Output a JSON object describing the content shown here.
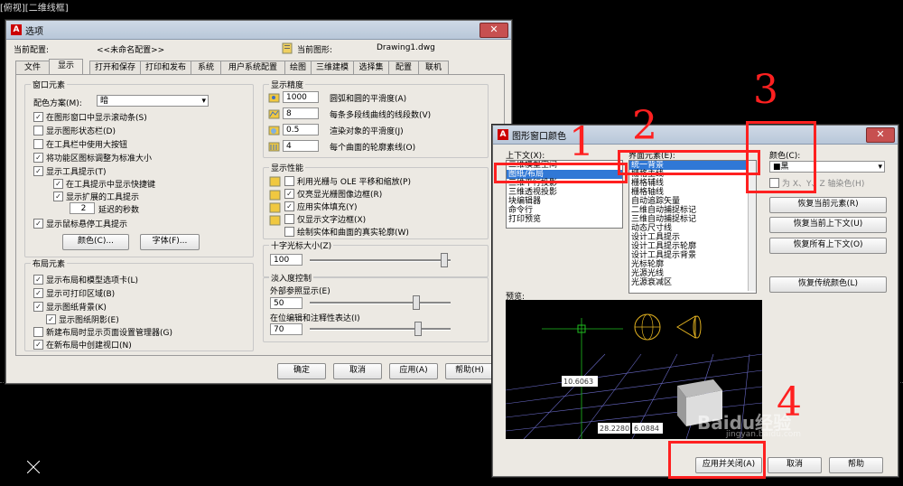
{
  "cad": {
    "title": "[俯视][二维线框]"
  },
  "options": {
    "title": "选项",
    "profile_label": "当前配置:",
    "profile_value": "<<未命名配置>>",
    "drawing_label": "当前图形:",
    "drawing_value": "Drawing1.dwg",
    "tabs": [
      "文件",
      "显示",
      "打开和保存",
      "打印和发布",
      "系统",
      "用户系统配置",
      "绘图",
      "三维建模",
      "选择集",
      "配置",
      "联机"
    ],
    "window": {
      "title": "窗口元素",
      "scheme_label": "配色方案(M):",
      "scheme_value": "暗",
      "checks": [
        "在图形窗口中显示滚动条(S)",
        "显示图形状态栏(D)",
        "在工具栏中使用大按钮",
        "将功能区图标调整为标准大小",
        "显示工具提示(T)",
        "在工具提示中显示快捷键",
        "显示扩展的工具提示",
        "显示鼠标悬停工具提示"
      ],
      "delay_value": "2",
      "delay_label": "延迟的秒数",
      "colors_btn": "颜色(C)...",
      "fonts_btn": "字体(F)..."
    },
    "layout": {
      "title": "布局元素",
      "checks": [
        "显示布局和模型选项卡(L)",
        "显示可打印区域(B)",
        "显示图纸背景(K)",
        "显示图纸阴影(E)",
        "新建布局时显示页面设置管理器(G)",
        "在新布局中创建视口(N)"
      ]
    },
    "resolution": {
      "title": "显示精度",
      "rows": [
        {
          "value": "1000",
          "label": "圆弧和圆的平滑度(A)"
        },
        {
          "value": "8",
          "label": "每条多段线曲线的线段数(V)"
        },
        {
          "value": "0.5",
          "label": "渲染对象的平滑度(J)"
        },
        {
          "value": "4",
          "label": "每个曲面的轮廓素线(O)"
        }
      ]
    },
    "performance": {
      "title": "显示性能",
      "checks": [
        "利用光栅与 OLE 平移和缩放(P)",
        "仅亮显光栅图像边框(R)",
        "应用实体填充(Y)",
        "仅显示文字边框(X)",
        "绘制实体和曲面的真实轮廓(W)"
      ]
    },
    "crosshair": {
      "title": "十字光标大小(Z)",
      "value": "100",
      "level": 1.0
    },
    "fade": {
      "title": "淡入度控制",
      "xref_label": "外部参照显示(E)",
      "xref_value": "50",
      "xref_level": 0.5,
      "inplace_label": "在位编辑和注释性表达(I)",
      "inplace_value": "70",
      "inplace_level": 0.7
    },
    "buttons": {
      "ok": "确定",
      "cancel": "取消",
      "apply": "应用(A)",
      "help": "帮助(H)"
    }
  },
  "colors_dialog": {
    "title": "图形窗口颜色",
    "context_label": "上下文(X):",
    "contexts": [
      "二维模型空间",
      "图纸/布局",
      "三维平行投影",
      "三维透视投影",
      "块编辑器",
      "命令行",
      "打印预览"
    ],
    "selected_context_index": 1,
    "element_label": "界面元素(E):",
    "elements": [
      "统一背景",
      "栅格主线",
      "栅格辅线",
      "栅格轴线",
      "自动追踪矢量",
      "二维自动捕捉标记",
      "三维自动捕捉标记",
      "动态尺寸线",
      "设计工具提示",
      "设计工具提示轮廓",
      "设计工具提示背景",
      "光标轮廓",
      "光源光线",
      "光源衰减区"
    ],
    "color_label": "颜色(C):",
    "color_value": "■黑",
    "tint_label": "为 X、Y、Z 轴染色(H)",
    "restore_element": "恢复当前元素(R)",
    "restore_context": "恢复当前上下文(U)",
    "restore_all": "恢复所有上下文(O)",
    "restore_classic": "恢复传统颜色(L)",
    "preview_label": "预览:",
    "preview_dims": [
      "10.6063",
      "28.2280",
      "6.0884"
    ],
    "apply_close": "应用并关闭(A)",
    "cancel": "取消",
    "help": "帮助"
  },
  "annotations": {
    "n1": "1",
    "n2": "2",
    "n3": "3",
    "n4": "4"
  },
  "watermark": {
    "text": "Baidu经验",
    "sub": "jingyan.baidu.com"
  }
}
